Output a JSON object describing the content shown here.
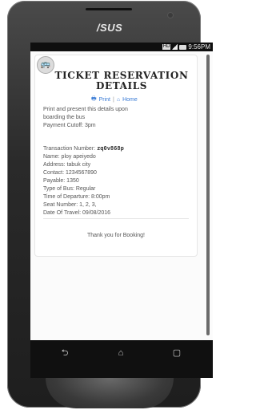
{
  "device": {
    "brand": "/SUS",
    "status_time": "9:56PM",
    "status_hd": "HD"
  },
  "header": {
    "title": "TICKET RESERVATION DETAILS",
    "links": {
      "print_icon": "print-icon",
      "print_label": "Print",
      "separator": "|",
      "home_icon": "home-icon",
      "home_label": "Home"
    }
  },
  "intro": {
    "line1": "Print and present this details upon",
    "line2": "boarding the bus",
    "line3": "Payment Cutoff: 3pm"
  },
  "ticket": {
    "transaction_label": "Transaction Number:",
    "transaction_value": "zq0v868p",
    "name": "Name: ploy apeiyedo",
    "address": "Address: tabuk city",
    "contact": "Contact: 1234567890",
    "payable": "Payable: 1350",
    "bus_type": "Type of Bus: Regular",
    "departure_time": "Time of Departure: 8:00pm",
    "seat_number": "Seat Number: 1, 2, 3,",
    "travel_date": "Date Of Travel: 09/08/2016"
  },
  "footer": {
    "thanks": "Thank you for Booking!"
  },
  "nav": {
    "back_icon": "back-icon",
    "home_icon": "home-nav-icon",
    "recent_icon": "recent-apps-icon"
  }
}
